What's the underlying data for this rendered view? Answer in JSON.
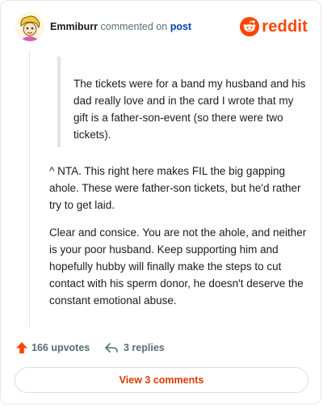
{
  "header": {
    "username": "Emmiburr",
    "action_text": "commented on",
    "post_link": "post",
    "brand": "reddit"
  },
  "comment": {
    "quote": "The tickets were for a band my husband and his dad really love and in the card I wrote that my gift is a father-son-event (so there were two tickets).",
    "paragraphs": [
      "^ NTA. This right here makes FIL the big gapping ahole. These were father-son tickets, but he'd rather try to get laid.",
      "Clear and consice. You are not the ahole, and neither is your poor husband. Keep supporting him and hopefully hubby will finally make the steps to cut contact with his sperm donor, he doesn't deserve the constant emotional abuse."
    ]
  },
  "footer": {
    "upvotes": "166 upvotes",
    "replies": "3 replies",
    "view_button": "View 3 comments"
  },
  "colors": {
    "brand": "#ff4500",
    "link": "#0045ac",
    "button_text": "#d93a00",
    "muted": "#576f76"
  },
  "icons": {
    "avatar": "avatar",
    "brand": "reddit-logo-icon",
    "upvote": "upvote-arrow-icon",
    "reply": "reply-arrow-icon"
  }
}
